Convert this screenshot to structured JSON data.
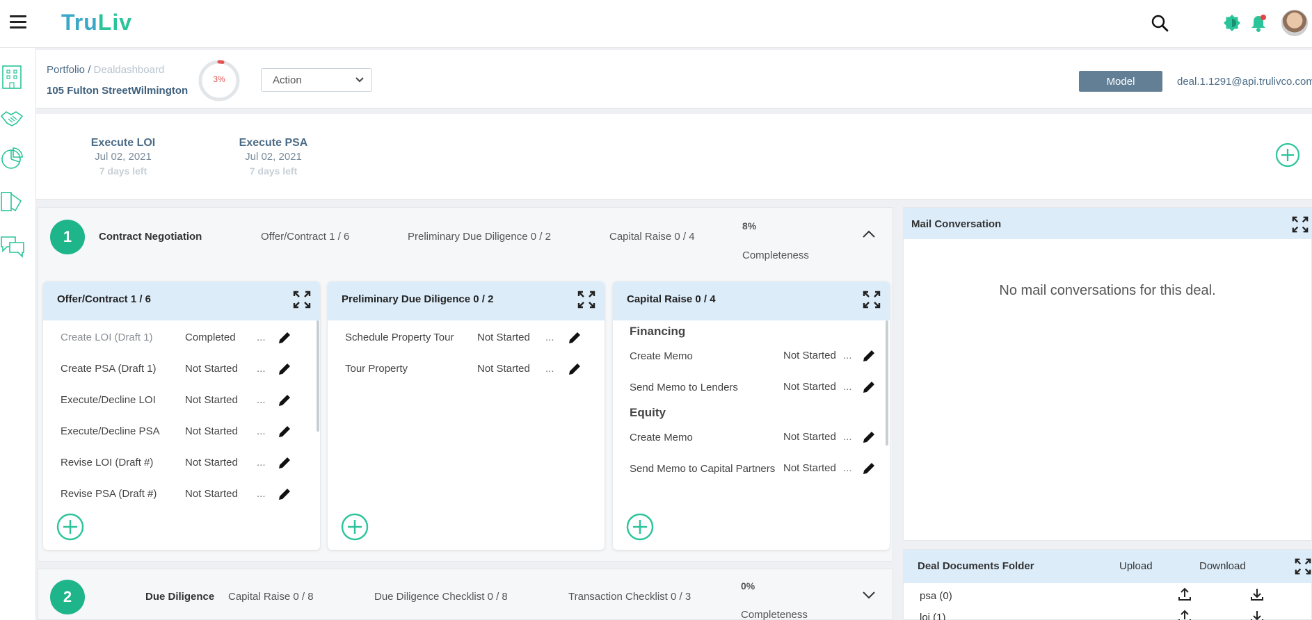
{
  "app": {
    "logo_a": "Tru",
    "logo_b": "Liv"
  },
  "header": {
    "breadcrumb_root": "Portfolio",
    "breadcrumb_sep": " / ",
    "breadcrumb_current": "Dealdashboard",
    "deal_name": "105 Fulton StreetWilmington",
    "progress_label": "3%",
    "progress_value": 3,
    "action_select": "Action",
    "model_button": "Model",
    "user_email": "deal.1.1291@api.trulivco.com"
  },
  "milestones": [
    {
      "title": "Execute LOI",
      "date": "Jul 02, 2021",
      "left": "7 days left"
    },
    {
      "title": "Execute PSA",
      "date": "Jul 02, 2021",
      "left": "7 days left"
    }
  ],
  "phase1": {
    "number": "1",
    "title": "Contract Negotiation",
    "summary": [
      "Offer/Contract 1 / 6",
      "Preliminary Due Diligence 0 / 2",
      "Capital Raise 0 / 4"
    ],
    "percent": "8%",
    "completeness_label": "Completeness"
  },
  "cards": {
    "offer": {
      "title": "Offer/Contract 1 / 6",
      "tasks": [
        {
          "name": "Create LOI (Draft 1)",
          "status": "Completed",
          "more": "..."
        },
        {
          "name": "Create PSA (Draft 1)",
          "status": "Not Started",
          "more": "..."
        },
        {
          "name": "Execute/Decline LOI",
          "status": "Not Started",
          "more": "..."
        },
        {
          "name": "Execute/Decline PSA",
          "status": "Not Started",
          "more": "..."
        },
        {
          "name": "Revise LOI (Draft #)",
          "status": "Not Started",
          "more": "..."
        },
        {
          "name": "Revise PSA (Draft #)",
          "status": "Not Started",
          "more": "..."
        }
      ]
    },
    "prelim": {
      "title": "Preliminary Due Diligence 0 / 2",
      "tasks": [
        {
          "name": "Schedule Property Tour",
          "status": "Not Started",
          "more": "..."
        },
        {
          "name": "Tour Property",
          "status": "Not Started",
          "more": "..."
        }
      ]
    },
    "capital": {
      "title": "Capital Raise 0 / 4",
      "group_financing": "Financing",
      "group_equity": "Equity",
      "tasks": [
        {
          "name": "Create Memo",
          "status": "Not Started",
          "more": "..."
        },
        {
          "name": "Send Memo to Lenders",
          "status": "Not Started",
          "more": "..."
        },
        {
          "name": "Create Memo",
          "status": "Not Started",
          "more": "..."
        },
        {
          "name": "Send Memo to Capital Partners",
          "status": "Not Started",
          "more": "..."
        }
      ]
    }
  },
  "phase2": {
    "number": "2",
    "title": "Due Diligence",
    "summary": [
      "Capital Raise 0 / 8",
      "Due Diligence Checklist 0 / 8",
      "Transaction Checklist 0 / 3"
    ],
    "percent": "0%",
    "completeness_label": "Completeness"
  },
  "mail": {
    "title": "Mail Conversation",
    "empty": "No mail conversations for this deal."
  },
  "docs": {
    "title": "Deal Documents Folder",
    "upload": "Upload",
    "download": "Download",
    "folders": [
      "psa (0)",
      "loi (1)"
    ]
  },
  "colors": {
    "accent": "#1fb58a",
    "panel_head": "#dcecf9",
    "model_button": "#627f96",
    "progress": "#e25454"
  }
}
